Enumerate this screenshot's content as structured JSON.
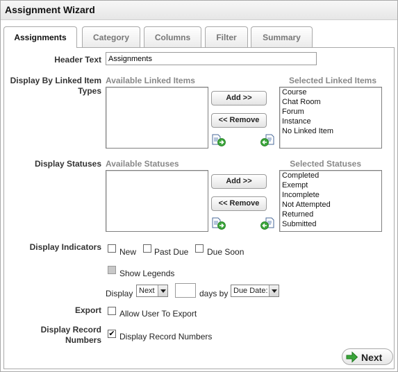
{
  "window": {
    "title": "Assignment Wizard"
  },
  "tabs": [
    {
      "label": "Assignments",
      "active": true
    },
    {
      "label": "Category"
    },
    {
      "label": "Columns"
    },
    {
      "label": "Filter"
    },
    {
      "label": "Summary"
    }
  ],
  "header_text": {
    "label": "Header Text",
    "value": "Assignments"
  },
  "linked_items": {
    "label": "Display By Linked Item Types",
    "available_title": "Available Linked Items",
    "selected_title": "Selected Linked Items",
    "available": [],
    "selected": [
      "Course",
      "Chat Room",
      "Forum",
      "Instance",
      "No Linked Item"
    ],
    "add_label": "Add >>",
    "remove_label": "<< Remove"
  },
  "statuses": {
    "label": "Display Statuses",
    "available_title": "Available Statuses",
    "selected_title": "Selected Statuses",
    "available": [],
    "selected": [
      "Completed",
      "Exempt",
      "Incomplete",
      "Not Attempted",
      "Returned",
      "Submitted"
    ],
    "add_label": "Add >>",
    "remove_label": "<< Remove"
  },
  "indicators": {
    "label": "Display Indicators",
    "options": [
      {
        "label": "New",
        "checked": false
      },
      {
        "label": "Past Due",
        "checked": false
      },
      {
        "label": "Due Soon",
        "checked": false
      }
    ],
    "show_legends": {
      "label": "Show Legends",
      "checked": false,
      "disabled": true
    },
    "display_prefix": "Display",
    "next_select": "Next",
    "days_value": "",
    "days_by_label": "days by",
    "date_select": "Due Date:"
  },
  "export": {
    "label": "Export",
    "option": "Allow User To Export",
    "checked": false
  },
  "record_numbers": {
    "label": "Display Record Numbers",
    "option": "Display Record Numbers",
    "checked": true
  },
  "next_button": {
    "label": "Next"
  },
  "colors": {
    "next_arrow": "#3aa53a",
    "border": "#a9a9a9"
  },
  "icons": {
    "move_right": "document-arrow-right-icon",
    "move_left": "document-arrow-left-icon",
    "next": "arrow-right-icon"
  }
}
